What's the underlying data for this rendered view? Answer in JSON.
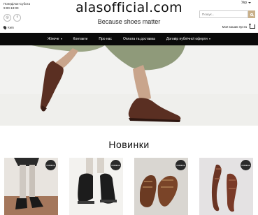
{
  "header": {
    "hours_line1": "Понеділок-Субота",
    "hours_line2": "9:00-19:00",
    "location": "Київ",
    "logo": "alasofficial.com",
    "tagline": "Because shoes matter",
    "language": "Укр",
    "search_placeholder": "Пошук...",
    "cart_label": "Моя кошик пуста"
  },
  "nav": {
    "items": [
      "Жіноче",
      "Контакти",
      "Про нас",
      "Оплата та доставка",
      "Договір публічної оферти"
    ]
  },
  "section": {
    "title": "Новинки"
  },
  "products": [
    {
      "badge": "новинка"
    },
    {
      "badge": "новинка"
    },
    {
      "badge": "новинка"
    },
    {
      "badge": "новинка"
    }
  ],
  "colors": {
    "navbar": "#0a0a0a",
    "accent": "#c9b08a",
    "badge": "#2a2a2a"
  }
}
